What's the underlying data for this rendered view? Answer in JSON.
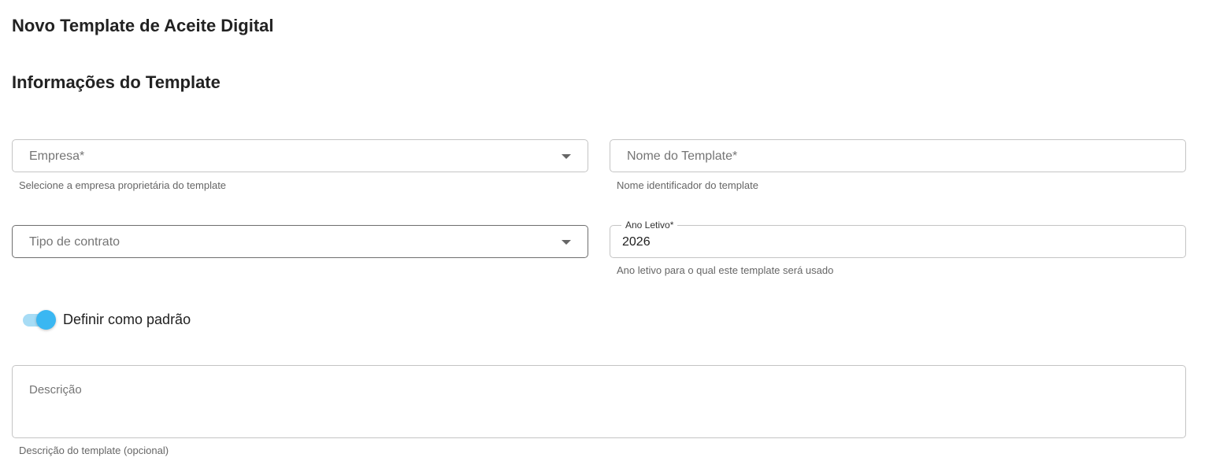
{
  "page": {
    "title": "Novo Template de Aceite Digital",
    "section_title": "Informações do Template"
  },
  "form": {
    "empresa": {
      "placeholder": "Empresa*",
      "helper": "Selecione a empresa proprietária do template"
    },
    "nome_template": {
      "placeholder": "Nome do Template*",
      "helper": "Nome identificador do template"
    },
    "tipo_contrato": {
      "placeholder": "Tipo de contrato"
    },
    "ano_letivo": {
      "label": "Ano Letivo*",
      "value": "2026",
      "helper": "Ano letivo para o qual este template será usado"
    },
    "padrao_toggle": {
      "label": "Definir como padrão",
      "checked": true
    },
    "descricao": {
      "placeholder": "Descrição",
      "helper": "Descrição do template (opcional)"
    }
  },
  "icons": {
    "dropdown": "chevron-down-icon"
  },
  "colors": {
    "toggle_thumb": "#3ab7f2",
    "toggle_track": "#a7dcf5",
    "border": "#c4c4c4",
    "helper_text": "#666666"
  }
}
